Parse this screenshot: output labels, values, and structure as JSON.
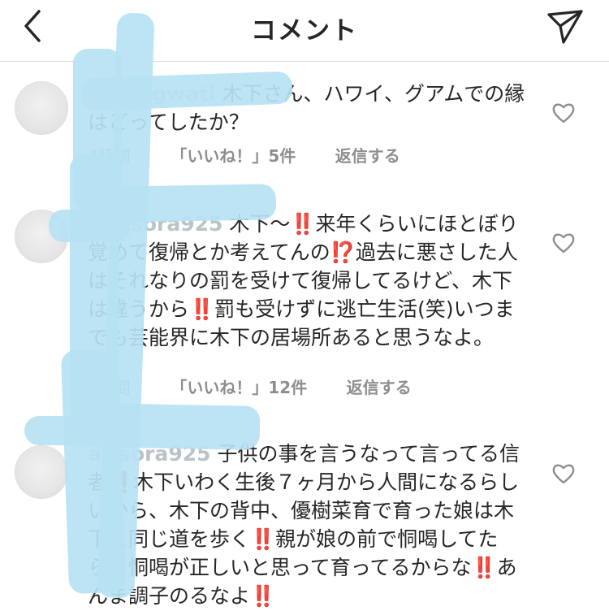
{
  "header": {
    "back_icon": "chevron-left-icon",
    "title": "コメント",
    "share_icon": "paper-plane-icon"
  },
  "comments": [
    {
      "username": "p         bhagwati",
      "text": "木下さん、ハワイ、グアムでの縁はどってしたか？",
      "time": "4時間",
      "likes": "「いいね！」5件",
      "reply": "返信する"
    },
    {
      "username": "as   _sora925",
      "text": "木下〜‼️来年くらいにほとぼり覚めて復帰とか考えてんの⁉️過去に悪さした人はそれなりの罰を受けて復帰してるけど、木下は違うから‼️罰も受けずに逃亡生活(笑)いつまでも芸能界に木下の居場所あると思うなよ。",
      "time": "3時間",
      "likes": "「いいね！」12件",
      "reply": "返信する"
    },
    {
      "username": "a     _sora925",
      "text": "子供の事を言うなって言ってる信者‼️木下いわく生後７ヶ月から人間になるらしいから、木下の背中、優樹菜育で育った娘は木下と同じ道を歩く‼️親が娘の前で恫喝してたら、恫喝が正しいと思って育ってるからな‼️あんま調子のるなよ‼️"
    }
  ],
  "colors": {
    "text": "#262626",
    "muted": "#8e8e8e",
    "redaction": "#b6e2f3",
    "divider": "#dbdbdb"
  }
}
